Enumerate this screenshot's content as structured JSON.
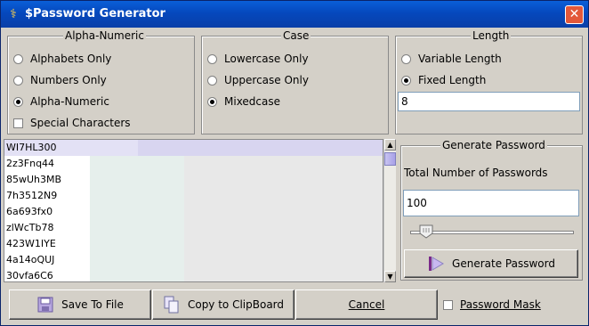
{
  "window": {
    "title": "$Password Generator",
    "close_glyph": "✕"
  },
  "alpha_numeric": {
    "legend": "Alpha-Numeric",
    "options": [
      "Alphabets Only",
      "Numbers Only",
      "Alpha-Numeric"
    ],
    "selected": "Alpha-Numeric",
    "special_characters_label": "Special Characters",
    "special_characters_checked": false
  },
  "case": {
    "legend": "Case",
    "options": [
      "Lowercase Only",
      "Uppercase Only",
      "Mixedcase"
    ],
    "selected": "Mixedcase"
  },
  "length": {
    "legend": "Length",
    "options": [
      "Variable Length",
      "Fixed Length"
    ],
    "selected": "Fixed Length",
    "value": "8"
  },
  "passwords": [
    "WI7HL300",
    "2z3Fnq44",
    "85wUh3MB",
    "7h3512N9",
    "6a693fx0",
    "zlWcTb78",
    "423W1IYE",
    "4a14oQUJ",
    "30vfa6C6"
  ],
  "generate": {
    "legend": "Generate Password",
    "count_label": "Total Number of Passwords",
    "count_value": "100",
    "button_label": "Generate Password"
  },
  "toolbar": {
    "save_label": "Save To File",
    "copy_label": "Copy to ClipBoard",
    "cancel_label": "Cancel",
    "mask_label": "Password Mask",
    "mask_checked": false
  },
  "icons": {
    "app": "caduceus-icon",
    "save": "floppy-disk-icon",
    "copy": "copy-documents-icon",
    "generate": "generate-bar-icon"
  }
}
